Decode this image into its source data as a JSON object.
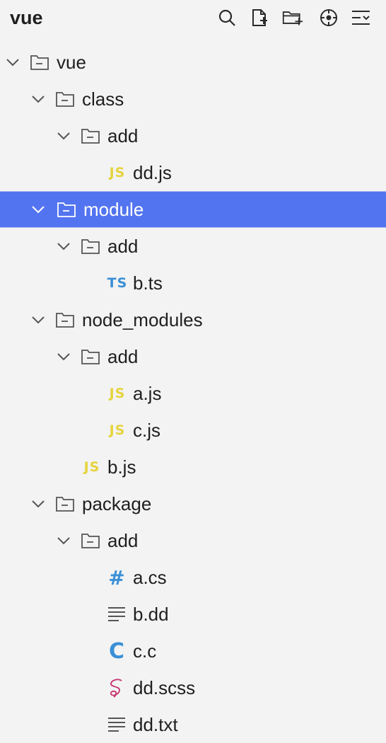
{
  "header": {
    "title": "vue"
  },
  "toolbar": {
    "icons": [
      "search-icon",
      "new-file-icon",
      "new-folder-icon",
      "locate-icon",
      "collapse-all-icon"
    ]
  },
  "colors": {
    "selected_bg": "#5374f0",
    "js_badge": "#e6d43d",
    "ts_badge": "#3a8fd6",
    "scss_icon": "#c6316d"
  },
  "tree": {
    "root": {
      "label": "vue"
    },
    "class": {
      "label": "class"
    },
    "class_add": {
      "label": "add"
    },
    "class_add_ddjs": {
      "label": "dd.js",
      "badge": "JS"
    },
    "module": {
      "label": "module"
    },
    "module_add": {
      "label": "add"
    },
    "module_add_bts": {
      "label": "b.ts",
      "badge": "TS"
    },
    "node_modules": {
      "label": "node_modules"
    },
    "node_modules_add": {
      "label": "add"
    },
    "node_modules_add_ajs": {
      "label": "a.js",
      "badge": "JS"
    },
    "node_modules_add_cjs": {
      "label": "c.js",
      "badge": "JS"
    },
    "node_modules_bjs": {
      "label": "b.js",
      "badge": "JS"
    },
    "package": {
      "label": "package"
    },
    "package_add": {
      "label": "add"
    },
    "package_add_acs": {
      "label": "a.cs",
      "badge": "#"
    },
    "package_add_bdd": {
      "label": "b.dd"
    },
    "package_add_cc": {
      "label": "c.c",
      "badge": "C"
    },
    "package_add_ddscss": {
      "label": "dd.scss"
    },
    "package_add_ddtxt": {
      "label": "dd.txt"
    }
  }
}
